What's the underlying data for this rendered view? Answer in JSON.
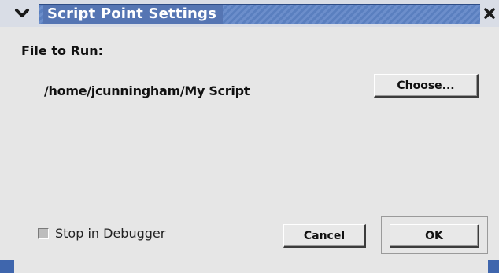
{
  "window": {
    "title": "Script Point Settings"
  },
  "form": {
    "file_label": "File to Run:",
    "file_path": "/home/jcunningham/My Script",
    "choose_label": "Choose...",
    "checkbox_label": "Stop in Debugger",
    "checkbox_checked": false,
    "cancel_label": "Cancel",
    "ok_label": "OK"
  },
  "icons": {
    "menu": "chevron-down-icon",
    "close": "close-icon"
  },
  "colors": {
    "titlebar_accent": "#5575b3",
    "window_background": "#e6e6e6"
  }
}
